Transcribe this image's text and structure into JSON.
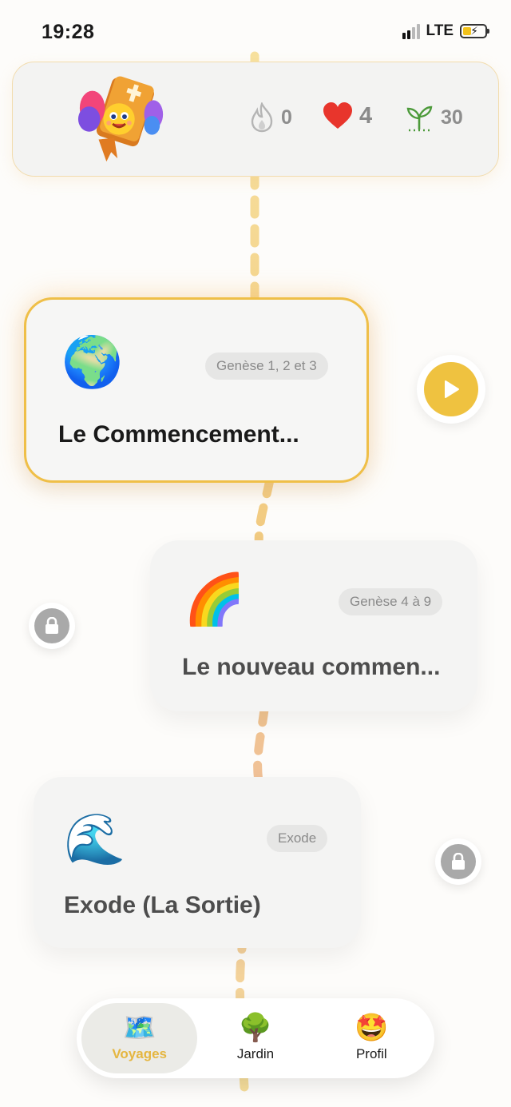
{
  "status_bar": {
    "time": "19:28",
    "network": "LTE"
  },
  "header": {
    "streak": "0",
    "hearts": "4",
    "seeds": "30",
    "icons": {
      "mascot": "bible-mascot-icon",
      "streak": "flame-icon",
      "hearts": "heart-icon",
      "seeds": "sprout-icon"
    }
  },
  "journeys": [
    {
      "emoji": "🌍",
      "reference": "Genèse 1, 2 et 3",
      "title": "Le Commencement...",
      "state": "active"
    },
    {
      "emoji": "🌈",
      "reference": "Genèse 4 à 9",
      "title": "Le nouveau commen...",
      "state": "locked"
    },
    {
      "emoji": "🌊",
      "reference": "Exode",
      "title": "Exode (La Sortie)",
      "state": "locked"
    }
  ],
  "tabs": [
    {
      "label": "Voyages",
      "icon": "🗺️",
      "active": true
    },
    {
      "label": "Jardin",
      "icon": "🌳",
      "active": false
    },
    {
      "label": "Profil",
      "icon": "🤩",
      "active": false
    }
  ],
  "colors": {
    "accent": "#efc240",
    "path_yellow": "#f4d57c",
    "path_orange": "#ecb67f",
    "heart": "#e8352c",
    "sprout": "#4c9a3a"
  }
}
